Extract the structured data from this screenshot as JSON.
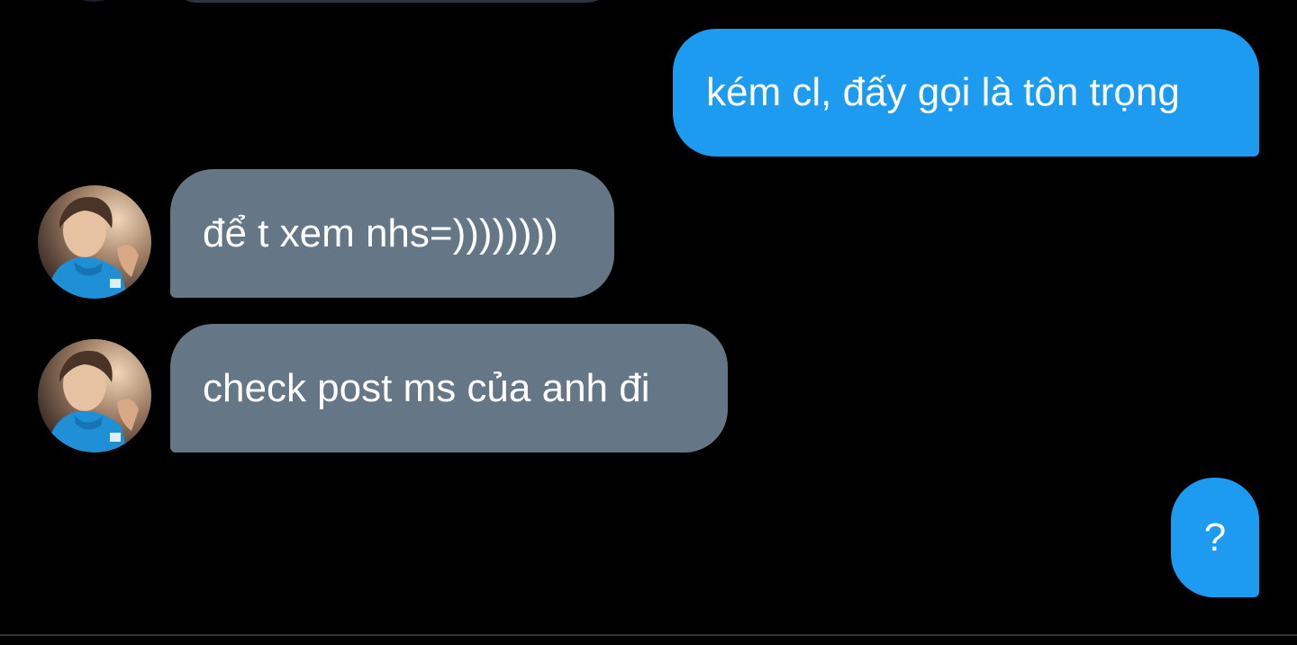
{
  "messages": [
    {
      "direction": "outgoing",
      "text": "kém cl, đấy gọi là tôn trọng"
    },
    {
      "direction": "incoming",
      "text": "để t xem nhs=))))))))"
    },
    {
      "direction": "incoming",
      "text": "check post ms của anh đi"
    },
    {
      "direction": "outgoing",
      "text": "?"
    }
  ],
  "colors": {
    "background": "#000000",
    "outgoing_bubble": "#1d9bf0",
    "incoming_bubble": "#657786",
    "text": "#ffffff"
  },
  "icons": {
    "avatar": "user-avatar-photo"
  }
}
